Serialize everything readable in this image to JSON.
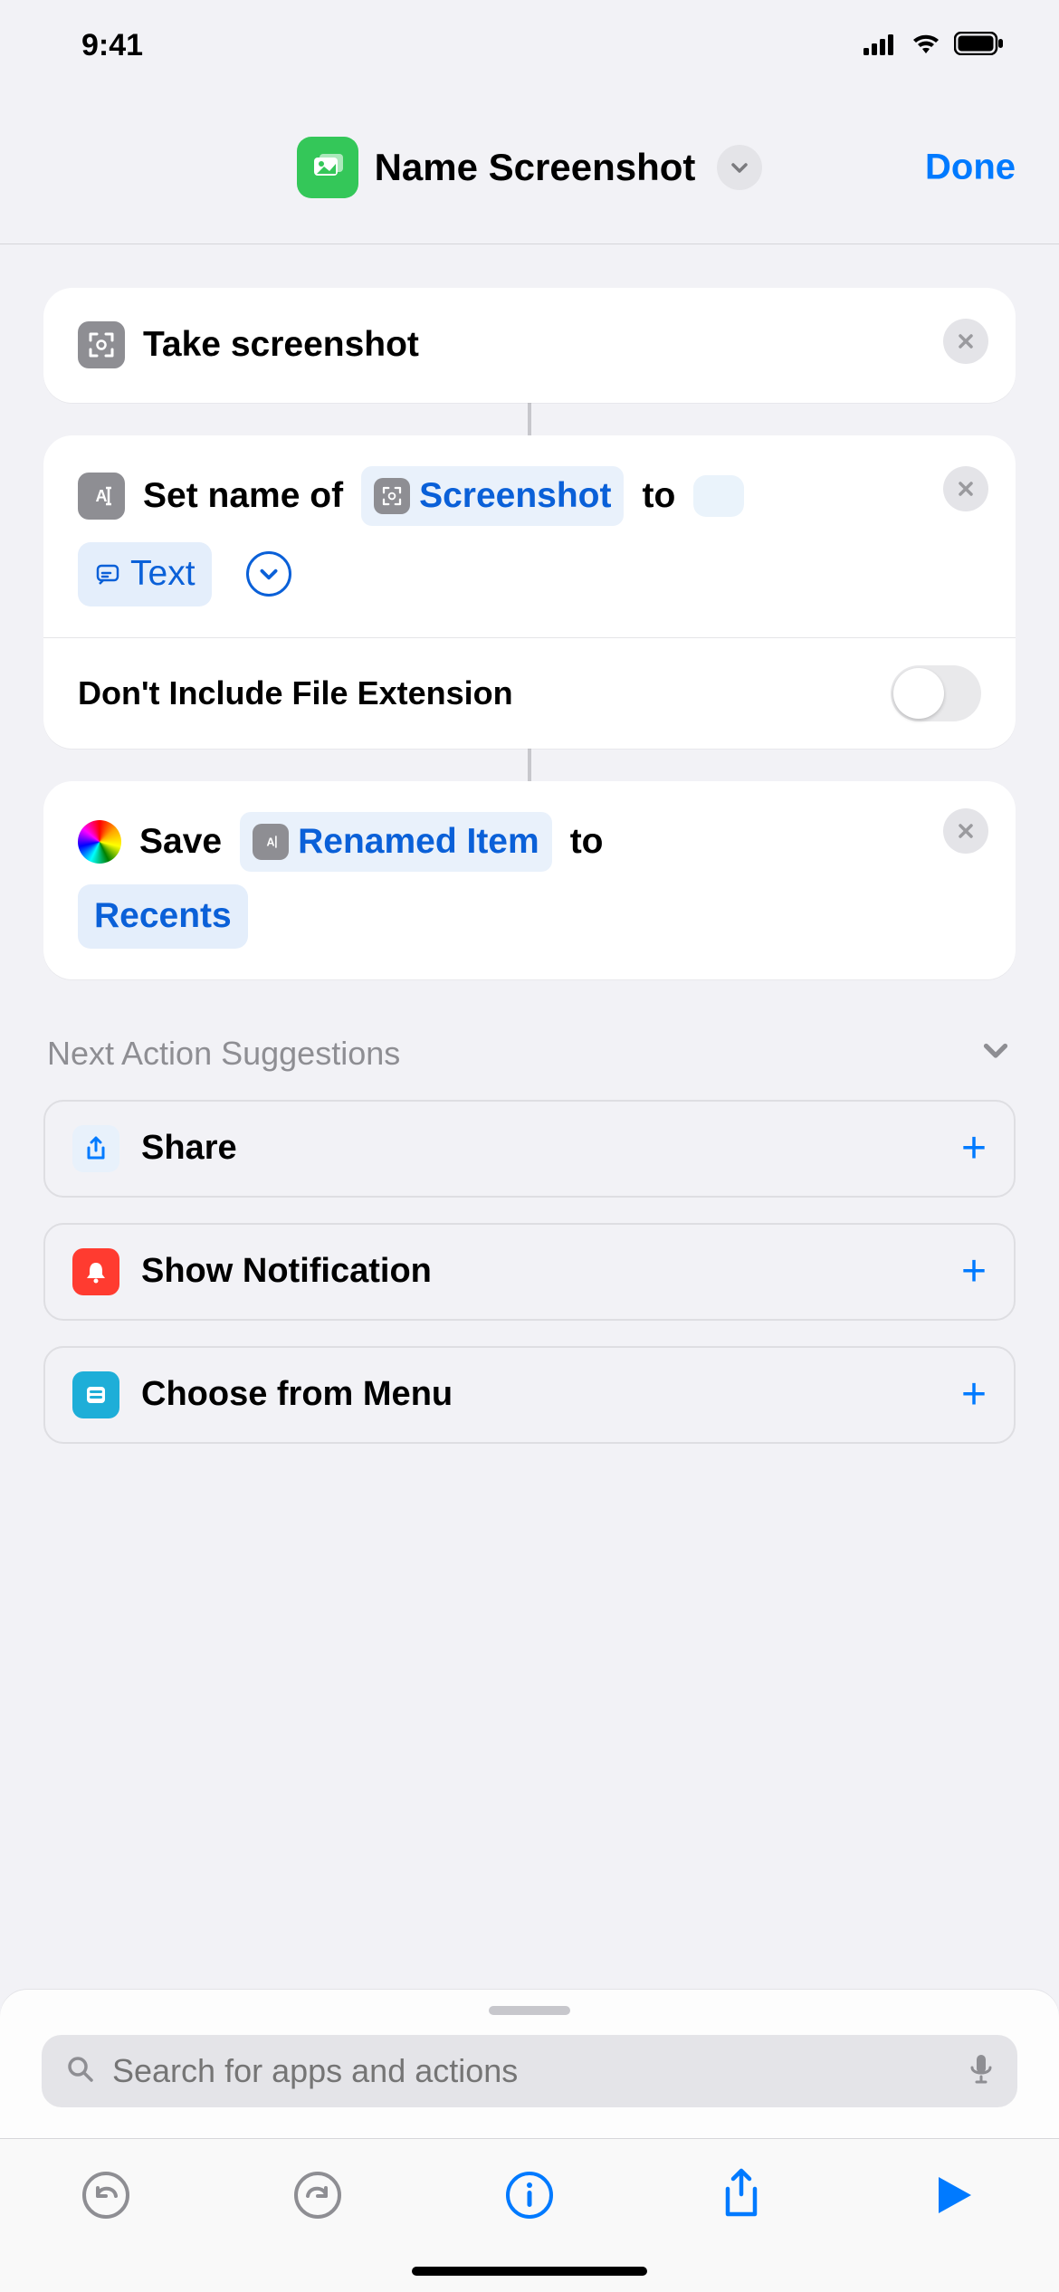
{
  "status": {
    "time": "9:41"
  },
  "header": {
    "title": "Name Screenshot",
    "done": "Done"
  },
  "actions": {
    "a1": {
      "label": "Take screenshot"
    },
    "a2": {
      "prefix": "Set name of",
      "input_token": "Screenshot",
      "mid": "to",
      "text_var": "Text",
      "option_label": "Don't Include File Extension"
    },
    "a3": {
      "prefix": "Save",
      "input_token": "Renamed Item",
      "mid": "to",
      "dest": "Recents"
    }
  },
  "suggestions": {
    "heading": "Next Action Suggestions",
    "items": [
      {
        "label": "Share",
        "icon": "share"
      },
      {
        "label": "Show Notification",
        "icon": "bell"
      },
      {
        "label": "Choose from Menu",
        "icon": "menu"
      }
    ]
  },
  "search": {
    "placeholder": "Search for apps and actions"
  }
}
